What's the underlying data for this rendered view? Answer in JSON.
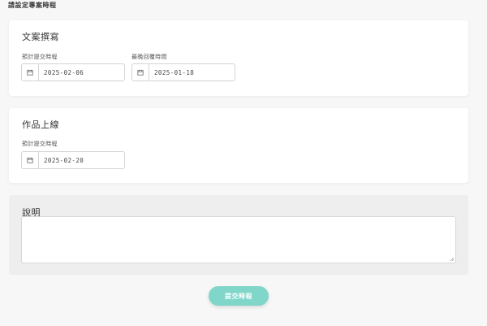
{
  "page": {
    "title": "請設定專案時程"
  },
  "sections": [
    {
      "title": "文案撰寫",
      "fields": [
        {
          "label": "預計提交時程",
          "value": "2025-02-06",
          "icon": "calendar-icon"
        },
        {
          "label": "最晚回覆時間",
          "value": "2025-01-18",
          "icon": "calendar-icon"
        }
      ]
    },
    {
      "title": "作品上線",
      "fields": [
        {
          "label": "預計提交時程",
          "value": "2025-02-20",
          "icon": "calendar-icon"
        }
      ]
    }
  ],
  "note": {
    "title": "說明",
    "value": ""
  },
  "submit": {
    "label": "提交時程"
  },
  "colors": {
    "accent": "#7fd6c9",
    "card_bg": "#ffffff",
    "note_bg": "#eeeeee",
    "page_bg": "#f7f7f7"
  }
}
